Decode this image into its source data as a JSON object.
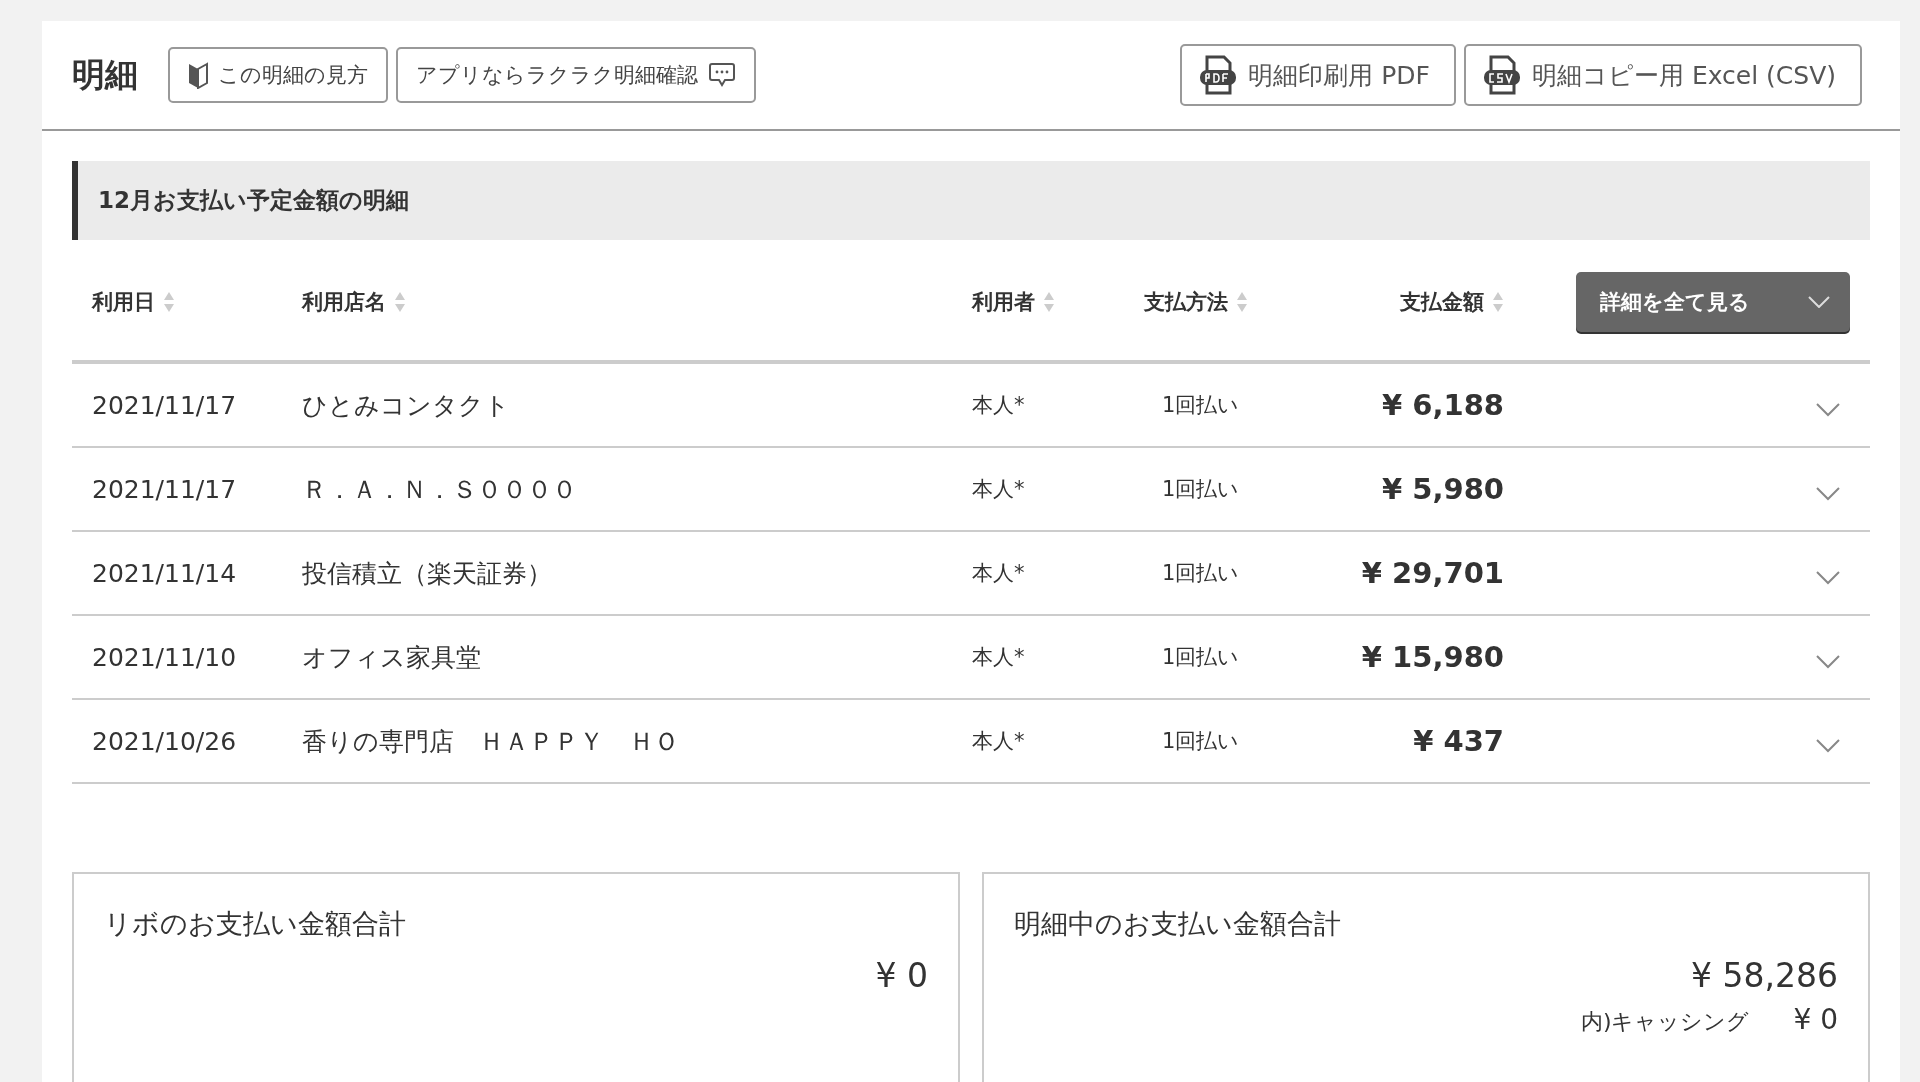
{
  "header": {
    "title": "明細",
    "guide_buttons": [
      {
        "kind": "beginner",
        "label": "この明細の見方"
      },
      {
        "kind": "app",
        "label": "アプリならラクラク明細確認"
      }
    ],
    "download_buttons": [
      {
        "kind": "pdf",
        "label": "明細印刷用 PDF"
      },
      {
        "kind": "csv",
        "label": "明細コピー用 Excel (CSV)"
      }
    ]
  },
  "section_title": "12月お支払い予定金額の明細",
  "table": {
    "columns": [
      "利用日",
      "利用店名",
      "利用者",
      "支払方法",
      "支払金額"
    ],
    "expand_all_button": "詳細を全て見る",
    "rows": [
      {
        "date": "2021/11/17",
        "store": "ひとみコンタクト",
        "user": "本人*",
        "method": "1回払い",
        "amount": "¥ 6,188"
      },
      {
        "date": "2021/11/17",
        "store": "Ｒ．Ａ．Ｎ．Ｓ００００",
        "user": "本人*",
        "method": "1回払い",
        "amount": "¥ 5,980"
      },
      {
        "date": "2021/11/14",
        "store": "投信積立（楽天証券）",
        "user": "本人*",
        "method": "1回払い",
        "amount": "¥ 29,701"
      },
      {
        "date": "2021/11/10",
        "store": "オフィス家具堂",
        "user": "本人*",
        "method": "1回払い",
        "amount": "¥ 15,980"
      },
      {
        "date": "2021/10/26",
        "store": "香りの専門店　ＨＡＰＰＹ　ＨＯ",
        "user": "本人*",
        "method": "1回払い",
        "amount": "¥ 437"
      }
    ]
  },
  "totals": [
    {
      "label": "リボのお支払い金額合計",
      "amount": "¥ 0"
    },
    {
      "label": "明細中のお支払い金額合計",
      "amount": "¥ 58,286",
      "sub_label": "内)キャッシング",
      "sub_amount": "¥ 0"
    }
  ]
}
